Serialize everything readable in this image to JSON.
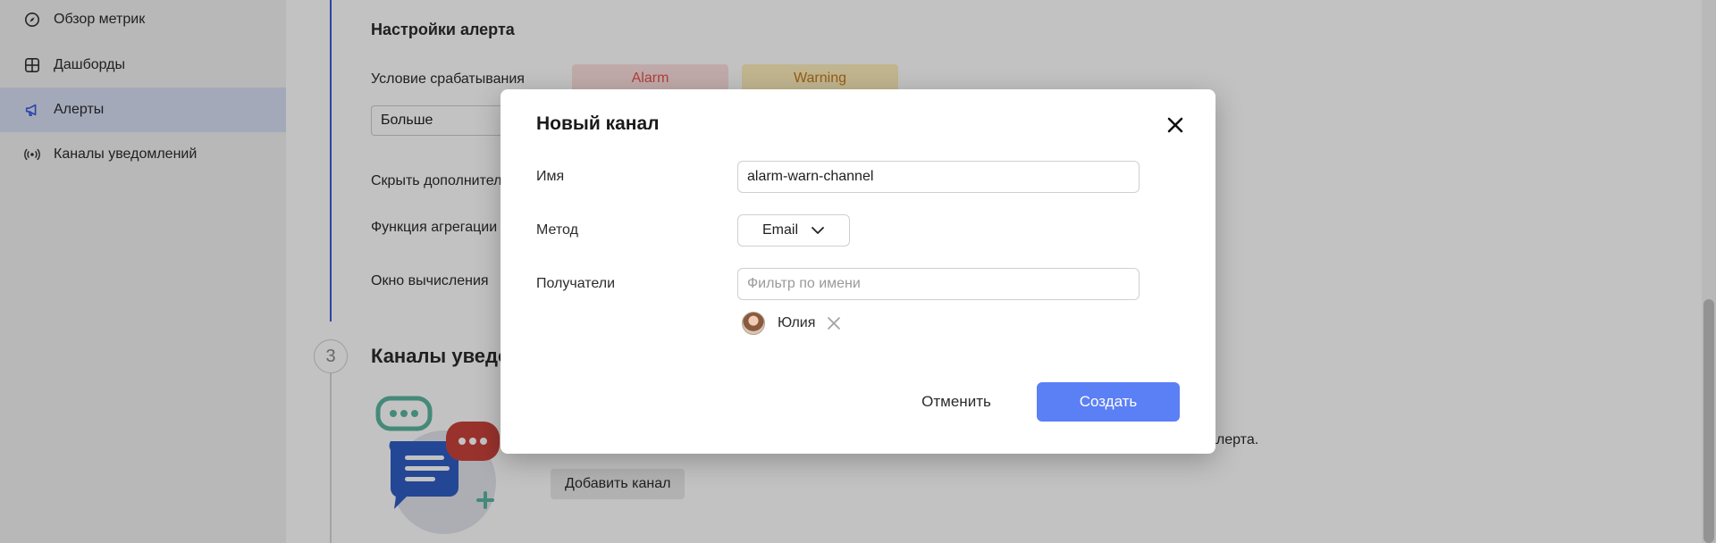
{
  "sidebar": {
    "items": [
      {
        "label": "Обзор метрик",
        "icon": "compass-icon"
      },
      {
        "label": "Дашборды",
        "icon": "dashboard-grid-icon"
      },
      {
        "label": "Алерты",
        "icon": "megaphone-icon",
        "active": true
      },
      {
        "label": "Каналы уведомлений",
        "icon": "broadcast-icon"
      }
    ]
  },
  "alert_settings": {
    "heading": "Настройки алерта",
    "condition_label": "Условие срабатывания",
    "alarm_chip": "Alarm",
    "warning_chip": "Warning",
    "comparison_value": "Больше",
    "hide_extra_label": "Скрыть дополнител",
    "aggregation_label": "Функция агрегации",
    "window_label": "Окно вычисления"
  },
  "channels_section": {
    "step_number": "3",
    "heading": "Каналы уведо",
    "description_tail": "алерта.",
    "add_channel_label": "Добавить канал"
  },
  "modal": {
    "title": "Новый канал",
    "name_label": "Имя",
    "name_value": "alarm-warn-channel",
    "method_label": "Метод",
    "method_value": "Email",
    "recipients_label": "Получатели",
    "recipients_placeholder": "Фильтр по имени",
    "recipients": [
      {
        "name": "Юлия"
      }
    ],
    "cancel_label": "Отменить",
    "create_label": "Создать"
  },
  "colors": {
    "accent": "#5b7ff5",
    "timeline": "#3b5bdb",
    "alarm": "#e5534b",
    "warning": "#c47a1c"
  }
}
